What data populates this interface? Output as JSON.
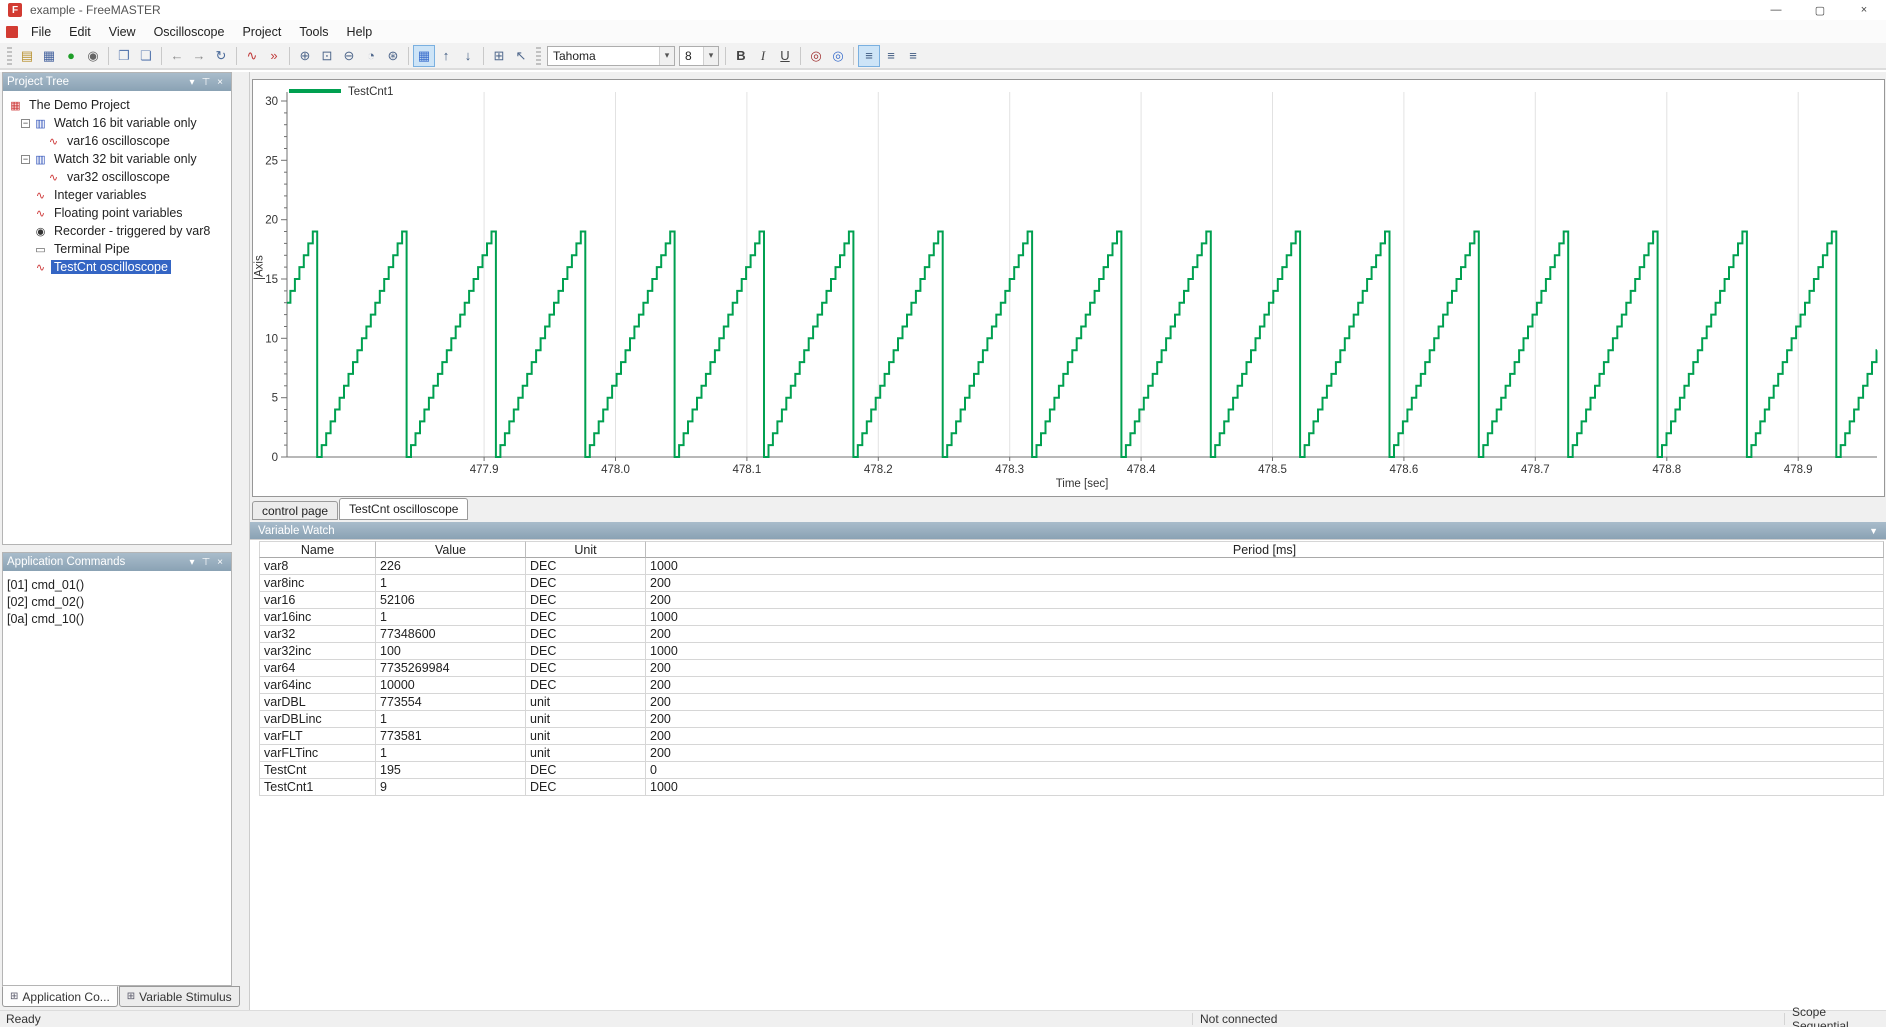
{
  "window": {
    "title": "example - FreeMASTER",
    "logo_letter": "F",
    "controls": {
      "minimize": "—",
      "maximize": "▢",
      "close": "×"
    }
  },
  "menu": {
    "items": [
      "File",
      "Edit",
      "View",
      "Oscilloscope",
      "Project",
      "Tools",
      "Help"
    ]
  },
  "toolbar": {
    "items": [
      {
        "type": "grip"
      },
      {
        "type": "icon",
        "name": "open-project-icon",
        "glyph": "▤",
        "color": "#b8912f"
      },
      {
        "type": "icon",
        "name": "save-project-icon",
        "glyph": "▦",
        "color": "#44629e"
      },
      {
        "type": "icon",
        "name": "start-stop-communication-icon",
        "glyph": "●",
        "color": "#1e9e28"
      },
      {
        "type": "icon",
        "name": "comm-config-icon",
        "glyph": "◉",
        "color": "#666666"
      },
      {
        "type": "sep"
      },
      {
        "type": "icon",
        "name": "copy-icon",
        "glyph": "❐",
        "color": "#5b7bb0"
      },
      {
        "type": "icon",
        "name": "paste-icon",
        "glyph": "❏",
        "color": "#5b7bb0"
      },
      {
        "type": "sep"
      },
      {
        "type": "icon",
        "name": "back-icon",
        "glyph": "←",
        "color": "#8a8a8a"
      },
      {
        "type": "icon",
        "name": "forward-icon",
        "glyph": "→",
        "color": "#8a8a8a"
      },
      {
        "type": "icon",
        "name": "reload-page-icon",
        "glyph": "↻",
        "color": "#4a6a9a"
      },
      {
        "type": "sep"
      },
      {
        "type": "icon",
        "name": "scope-icon",
        "glyph": "∿",
        "color": "#c03a3a"
      },
      {
        "type": "icon",
        "name": "run-fast-icon",
        "glyph": "»",
        "color": "#c03a3a"
      },
      {
        "type": "sep"
      },
      {
        "type": "icon",
        "name": "zoom-in-icon",
        "glyph": "⊕",
        "color": "#50688c"
      },
      {
        "type": "icon",
        "name": "zoom-fit-icon",
        "glyph": "⊡",
        "color": "#50688c"
      },
      {
        "type": "icon",
        "name": "zoom-out-icon",
        "glyph": "⊖",
        "color": "#50688c"
      },
      {
        "type": "icon",
        "name": "clock-icon",
        "glyph": "◔",
        "color": "#50688c"
      },
      {
        "type": "icon",
        "name": "snapshot-icon",
        "glyph": "⊛",
        "color": "#50688c"
      },
      {
        "type": "sep"
      },
      {
        "type": "icon",
        "name": "grid-toggle-icon",
        "glyph": "▦",
        "color": "#3a6ecc",
        "active": true
      },
      {
        "type": "icon",
        "name": "move-up-icon",
        "glyph": "↑",
        "color": "#3e5a80"
      },
      {
        "type": "icon",
        "name": "move-down-icon",
        "glyph": "↓",
        "color": "#3e5a80"
      },
      {
        "type": "sep"
      },
      {
        "type": "icon",
        "name": "properties-icon",
        "glyph": "⊞",
        "color": "#50688c"
      },
      {
        "type": "icon",
        "name": "context-help-icon",
        "glyph": "↖",
        "color": "#50688c"
      },
      {
        "type": "grip"
      },
      {
        "type": "combo",
        "name": "font-family-select",
        "value": "Tahoma",
        "width": 128
      },
      {
        "type": "combo",
        "name": "font-size-select",
        "value": "8",
        "width": 40
      },
      {
        "type": "sep"
      },
      {
        "type": "icon",
        "name": "bold-icon",
        "glyph": "B",
        "color": "#444444",
        "style": "bold"
      },
      {
        "type": "icon",
        "name": "italic-icon",
        "glyph": "I",
        "color": "#444444",
        "style": "italic"
      },
      {
        "type": "icon",
        "name": "underline-icon",
        "glyph": "U",
        "color": "#444444",
        "style": "underline"
      },
      {
        "type": "sep"
      },
      {
        "type": "icon",
        "name": "text-color-icon",
        "glyph": "◎",
        "color": "#a03030"
      },
      {
        "type": "icon",
        "name": "fill-color-icon",
        "glyph": "◎",
        "color": "#3a6ecc"
      },
      {
        "type": "sep"
      },
      {
        "type": "icon",
        "name": "align-left-icon",
        "glyph": "≡",
        "color": "#3e5a80",
        "active": true
      },
      {
        "type": "icon",
        "name": "align-center-icon",
        "glyph": "≡",
        "color": "#3e5a80"
      },
      {
        "type": "icon",
        "name": "align-right-icon",
        "glyph": "≡",
        "color": "#3e5a80"
      }
    ]
  },
  "icons": {
    "project": {
      "glyph": "▦",
      "color": "#cc3333"
    },
    "watch": {
      "glyph": "▥",
      "color": "#3355bb"
    },
    "scope": {
      "glyph": "∿",
      "color": "#cc3333"
    },
    "recorder": {
      "glyph": "◉",
      "color": "#333333"
    },
    "terminal": {
      "glyph": "▭",
      "color": "#555555"
    }
  },
  "project_tree": {
    "title": "Project Tree",
    "items": [
      {
        "label": "The Demo Project",
        "depth": 0,
        "icon": "project"
      },
      {
        "label": "Watch 16 bit variable only",
        "depth": 1,
        "icon": "watch",
        "expand": "minus"
      },
      {
        "label": "var16 oscilloscope",
        "depth": 2,
        "icon": "scope"
      },
      {
        "label": "Watch 32 bit variable only",
        "depth": 1,
        "icon": "watch",
        "expand": "minus"
      },
      {
        "label": "var32 oscilloscope",
        "depth": 2,
        "icon": "scope"
      },
      {
        "label": "Integer variables",
        "depth": 1,
        "icon": "scope"
      },
      {
        "label": "Floating point variables",
        "depth": 1,
        "icon": "scope"
      },
      {
        "label": "Recorder - triggered by var8",
        "depth": 1,
        "icon": "recorder"
      },
      {
        "label": "Terminal Pipe",
        "depth": 1,
        "icon": "terminal"
      },
      {
        "label": "TestCnt oscilloscope",
        "depth": 1,
        "icon": "scope",
        "selected": true
      }
    ]
  },
  "app_commands": {
    "title": "Application Commands",
    "items": [
      "[01] cmd_01()",
      "[02] cmd_02()",
      "[0a] cmd_10()"
    ],
    "tabs": [
      "Application Co...",
      "Variable Stimulus"
    ]
  },
  "scope": {
    "tabs": [
      "control page",
      "TestCnt oscilloscope"
    ],
    "active_tab": "TestCnt oscilloscope",
    "y_axis_label": "|Axis"
  },
  "variable_watch": {
    "title": "Variable Watch",
    "columns": [
      "Name",
      "Value",
      "Unit",
      "Period [ms]"
    ],
    "rows": [
      [
        "var8",
        "226",
        "DEC",
        "1000"
      ],
      [
        "var8inc",
        "1",
        "DEC",
        "200"
      ],
      [
        "var16",
        "52106",
        "DEC",
        "200"
      ],
      [
        "var16inc",
        "1",
        "DEC",
        "1000"
      ],
      [
        "var32",
        "77348600",
        "DEC",
        "200"
      ],
      [
        "var32inc",
        "100",
        "DEC",
        "1000"
      ],
      [
        "var64",
        "7735269984",
        "DEC",
        "200"
      ],
      [
        "var64inc",
        "10000",
        "DEC",
        "200"
      ],
      [
        "varDBL",
        "773554",
        "unit",
        "200"
      ],
      [
        "varDBLinc",
        "1",
        "unit",
        "200"
      ],
      [
        "varFLT",
        "773581",
        "unit",
        "200"
      ],
      [
        "varFLTinc",
        "1",
        "unit",
        "200"
      ],
      [
        "TestCnt",
        "195",
        "DEC",
        "0"
      ],
      [
        "TestCnt1",
        "9",
        "DEC",
        "1000"
      ]
    ]
  },
  "statusbar": {
    "ready": "Ready",
    "connection": "Not connected",
    "scope_mode": "Scope Sequential"
  },
  "chart_data": {
    "type": "line",
    "title": "",
    "series": [
      {
        "name": "TestCnt1",
        "color": "#00A050"
      }
    ],
    "xlabel": "Time [sec]",
    "ylabel": "|Axis",
    "x_range": [
      477.75,
      478.96
    ],
    "y_range": [
      0,
      30.5
    ],
    "x_ticks": [
      477.9,
      478.0,
      478.1,
      478.2,
      478.3,
      478.4,
      478.5,
      478.6,
      478.7,
      478.8,
      478.9
    ],
    "y_ticks": [
      0,
      5,
      10,
      15,
      20,
      25,
      30
    ],
    "grid": "vertical-only",
    "legend_position": "top-left",
    "waveform": {
      "shape": "staircase-sawtooth",
      "min": 0,
      "max": 19,
      "steps_per_ramp": 20,
      "period_sec": 0.068,
      "ramp_origin_sec": 477.705,
      "last_value": 9
    }
  }
}
